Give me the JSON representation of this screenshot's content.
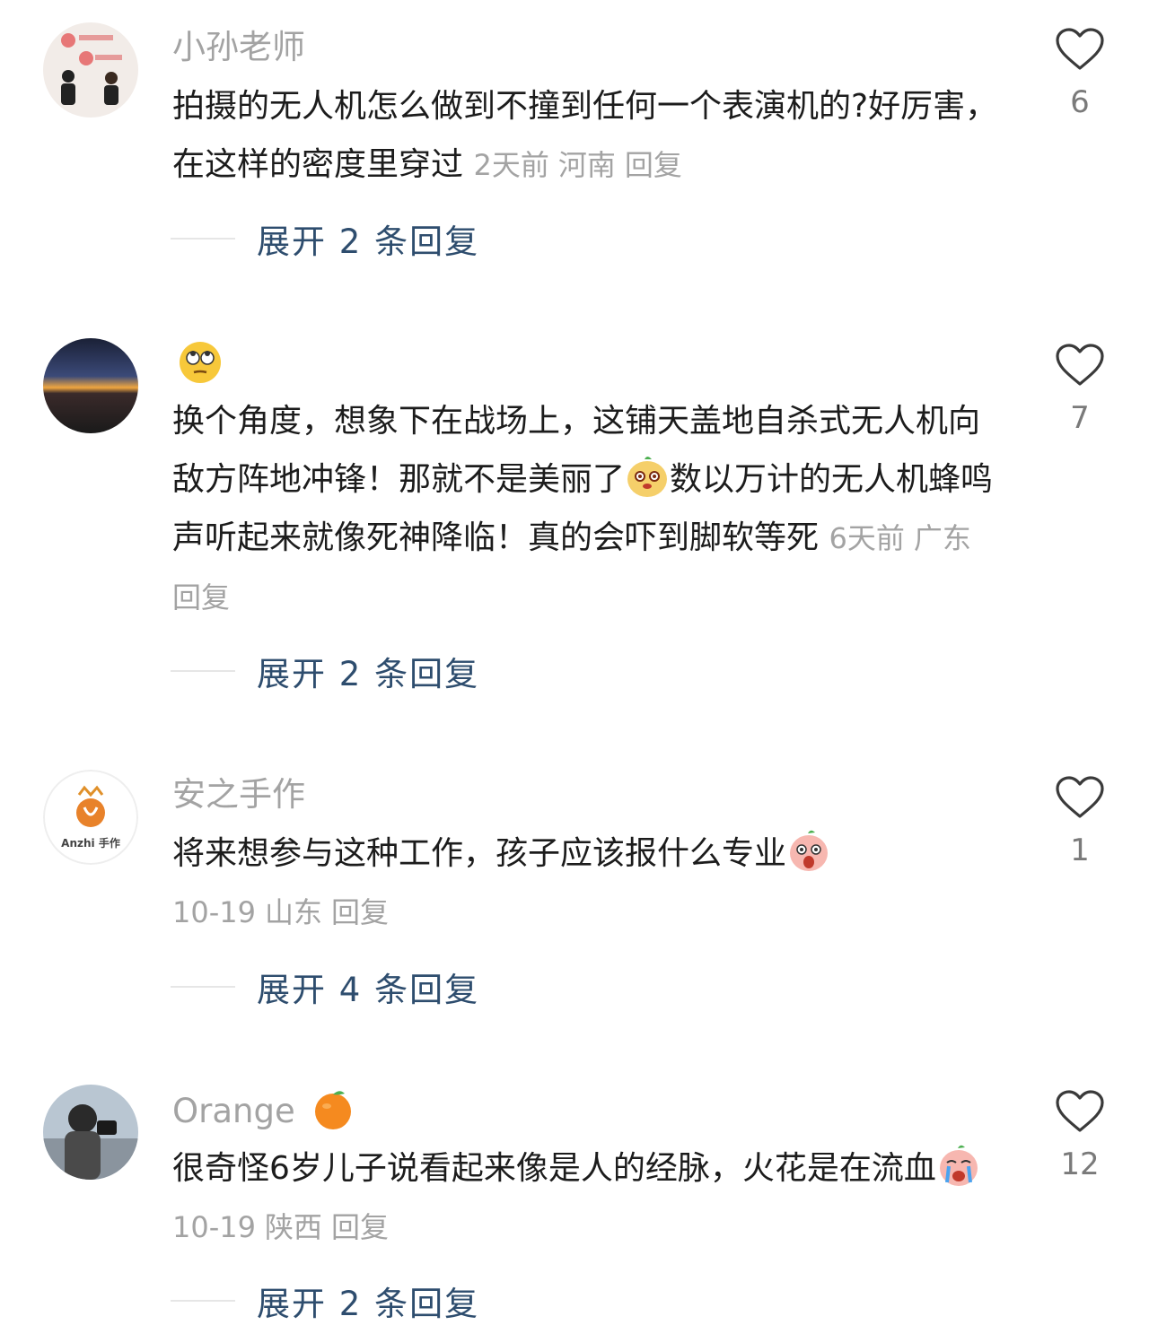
{
  "comments": [
    {
      "username": "小孙老师",
      "text": "拍摄的无人机怎么做到不撞到任何一个表演机的?好厉害，在这样的密度里穿过",
      "time": "2天前",
      "location": "河南",
      "reply_label": "回复",
      "likes": "6",
      "expand_label": "展开 2 条回复"
    },
    {
      "username": "",
      "name_emoji": "eye-roll-emoji",
      "text_part1": "换个角度，想象下在战场上，这铺天盖地自杀式无人机向敌方阵地冲锋！那就不是美丽了",
      "text_part2": "数以万计的无人机蜂鸣声听起来就像死神降临！真的会吓到脚软等死",
      "time": "6天前",
      "location": "广东",
      "reply_label": "回复",
      "likes": "7",
      "expand_label": "展开 2 条回复"
    },
    {
      "username": "安之手作",
      "avatar_text": "Anzhi 手作",
      "text": "将来想参与这种工作，孩子应该报什么专业",
      "time": "10-19",
      "location": "山东",
      "reply_label": "回复",
      "likes": "1",
      "expand_label": "展开 4 条回复"
    },
    {
      "username": "Orange",
      "name_emoji": "orange-emoji",
      "text": "很奇怪6岁儿子说看起来像是人的经脉，火花是在流血",
      "time": "10-19",
      "location": "陕西",
      "reply_label": "回复",
      "likes": "12",
      "expand_label": "展开 2 条回复"
    }
  ],
  "colors": {
    "username": "#a3a3a3",
    "text": "#1c1c1c",
    "meta": "#a3a3a3",
    "expand": "#2e4d6e"
  }
}
